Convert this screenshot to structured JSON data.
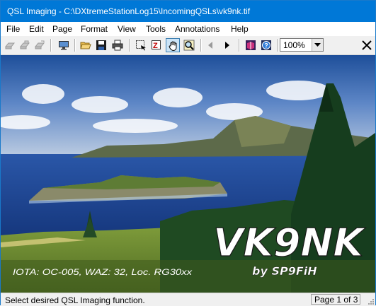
{
  "window": {
    "title": "QSL Imaging - C:\\DXtremeStationLog15\\IncomingQSLs\\vk9nk.tif"
  },
  "menu": {
    "items": [
      "File",
      "Edit",
      "Page",
      "Format",
      "View",
      "Tools",
      "Annotations",
      "Help"
    ]
  },
  "toolbar": {
    "icons": [
      "scan-icon",
      "scan-batch-icon",
      "scan-multi-icon",
      "monitor-icon",
      "open-folder-icon",
      "save-disk-icon",
      "printer-icon",
      "select-region-icon",
      "zoom-rect-icon",
      "hand-pan-icon",
      "zoom-magnifier-icon",
      "prev-page-icon",
      "next-page-icon",
      "book-icon",
      "help-icon",
      "close-icon"
    ],
    "zoom_value": "100%"
  },
  "qsl_card": {
    "callsign": "VK9NK",
    "byline": "by SP9FiH",
    "info": "IOTA: OC-005, WAZ: 32, Loc. RG30xx",
    "colors": {
      "sky_top": "#1e4f9a",
      "sky_bottom": "#b9c9de",
      "sea": "#1a3f8c",
      "island": "#5d6a4a",
      "grass": "#6f8a2e",
      "trees": "#163d1e"
    }
  },
  "status": {
    "message": "Select desired QSL Imaging function.",
    "page": "Page 1 of 3"
  }
}
